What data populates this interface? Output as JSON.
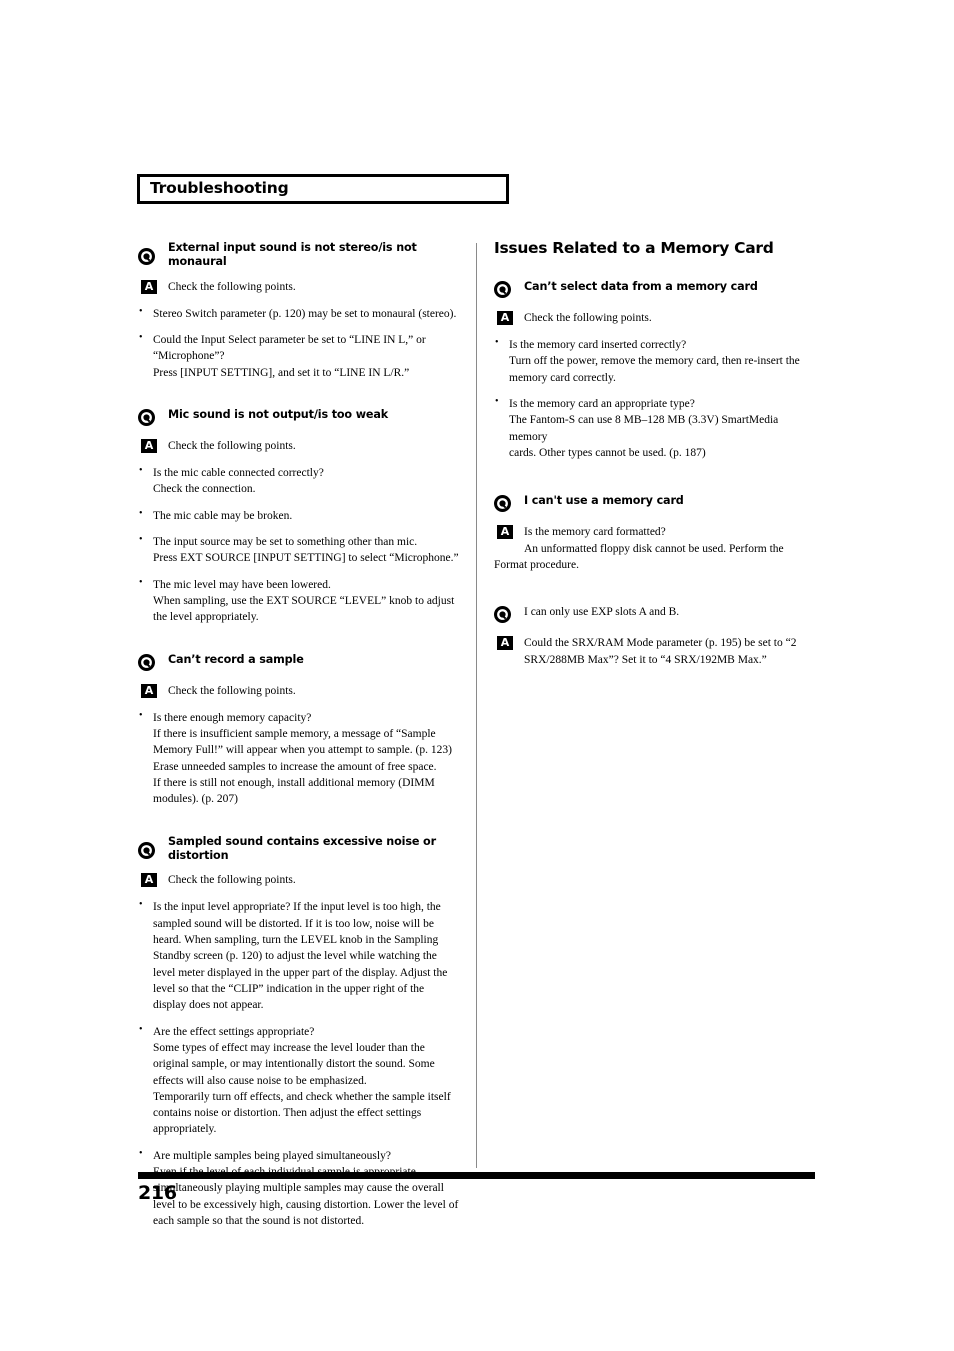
{
  "page": {
    "running_head": "Troubleshooting",
    "page_number": "216",
    "icons": {
      "question": "question-mark-circle-icon",
      "answer": "answer-badge-icon",
      "bullet": "bullet-icon"
    },
    "colors": {
      "ink": "#000000",
      "paper": "#ffffff",
      "rule": "#8a8a8a"
    }
  },
  "left_column": {
    "blocks": [
      {
        "question": "External input sound is not stereo/is not monaural",
        "answer_label": "A",
        "answer": "Check the following points.",
        "points": [
          [
            "Stereo Switch parameter (p. 120) may be set to monaural (stereo)."
          ],
          [
            "Could the Input Select parameter be set to “LINE IN L,” or",
            "“Microphone”?",
            "Press [INPUT SETTING], and set it to “LINE IN L/R.”"
          ]
        ]
      },
      {
        "question": "Mic sound is not output/is too weak",
        "answer_label": "A",
        "answer": "Check the following points.",
        "points": [
          [
            "Is the mic cable connected correctly?",
            "Check the connection."
          ],
          [
            "The mic cable may be broken."
          ],
          [
            "The input source may be set to something other than mic.",
            "Press EXT SOURCE [INPUT SETTING] to select “Microphone.”"
          ],
          [
            "The mic level may have been lowered.",
            "When sampling, use the EXT SOURCE “LEVEL” knob to adjust",
            "the level appropriately."
          ]
        ]
      },
      {
        "question": "Can’t record a sample",
        "answer_label": "A",
        "answer": "Check the following points.",
        "points": [
          [
            "Is there enough memory capacity?",
            "If there is insufficient sample memory, a message of “Sample",
            "Memory Full!” will appear when you attempt to sample. (p. 123)",
            "Erase unneeded samples to increase the amount of free space.",
            "If there is still not enough, install additional memory (DIMM",
            "modules). (p. 207)"
          ]
        ]
      },
      {
        "question": "Sampled sound contains excessive noise or distortion",
        "answer_label": "A",
        "answer": "Check the following points.",
        "points": [
          [
            "Is the input level appropriate? If the input level is too high, the",
            "sampled sound will be distorted. If it is too low, noise will be",
            "heard. When sampling, turn the LEVEL knob in the Sampling",
            "Standby screen (p. 120) to adjust the level while watching the",
            "level meter displayed in the upper part of the display. Adjust the",
            "level so that the “CLIP” indication in the upper right of the",
            "display does not appear."
          ],
          [
            "Are the effect settings appropriate?",
            "Some types of effect may increase the level louder than the",
            "original sample, or may intentionally distort the sound. Some",
            "effects will also cause noise to be emphasized.",
            "Temporarily turn off effects, and check whether the sample itself",
            "contains noise or distortion. Then adjust the effect settings",
            "appropriately."
          ],
          [
            "Are multiple samples being played simultaneously?",
            "Even if the level of each individual sample is appropriate,",
            "simultaneously playing multiple samples may cause the overall",
            "level to be excessively high, causing distortion. Lower the level of",
            "each sample so that the sound is not distorted."
          ]
        ]
      }
    ]
  },
  "right_column": {
    "section_title": "Issues Related to a Memory Card",
    "blocks": [
      {
        "question": "Can’t select data from a memory card",
        "answer_label": "A",
        "answer": "Check the following points.",
        "points": [
          [
            "Is the memory card inserted correctly?",
            "Turn off the power, remove the memory card, then re-insert the",
            "memory card correctly."
          ],
          [
            "Is the memory card an appropriate type?",
            "The Fantom-S can use 8 MB–128 MB (3.3V) SmartMedia memory",
            "cards. Other types cannot be used. (p. 187)"
          ]
        ]
      },
      {
        "question": "I can't use a memory card",
        "answer_label": "A",
        "answer_lines": [
          "Is the memory card formatted?",
          "An unformatted floppy disk cannot be used. Perform the",
          "Format procedure."
        ]
      },
      {
        "question": "I can only use EXP slots A and B.",
        "question_style": "plain",
        "answer_label": "A",
        "answer_lines": [
          "Could the SRX/RAM Mode parameter (p. 195) be set to “2",
          "SRX/288MB Max”? Set it to “4 SRX/192MB Max.”"
        ]
      }
    ]
  }
}
